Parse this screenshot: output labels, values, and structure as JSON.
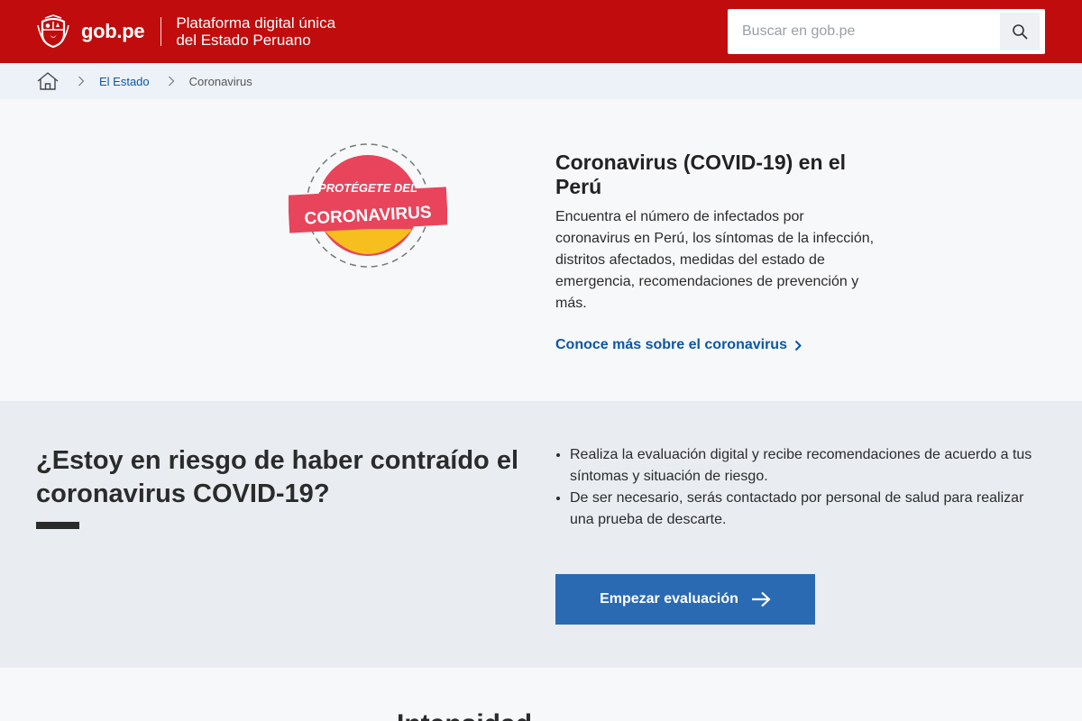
{
  "header": {
    "logo_text": "gob.pe",
    "tagline_line1": "Plataforma digital única",
    "tagline_line2": "del Estado Peruano",
    "search_placeholder": "Buscar en gob.pe",
    "brand_color": "#c00c0c"
  },
  "breadcrumb": {
    "items": [
      {
        "label": "El Estado"
      },
      {
        "label": "Coronavirus"
      }
    ]
  },
  "hero": {
    "badge_line1": "PROTÉGETE DEL",
    "badge_line2": "CORONAVIRUS",
    "title": "Coronavirus (COVID-19) en el Perú",
    "description": "Encuentra el número de infectados por coronavirus en Perú, los síntomas de la infección, distritos afectados, medidas del estado de emergencia, recomendaciones de prevención y más.",
    "link_label": "Conoce más sobre el coronavirus",
    "link_color": "#0b57a7"
  },
  "risk": {
    "title": "¿Estoy en riesgo de haber contraído el coronavirus COVID-19?",
    "bullets": [
      "Realiza la evaluación digital y recibe recomendaciones de acuerdo a tus síntomas y situación de riesgo.",
      "De ser necesario, serás contactado por personal de salud para realizar una prueba de descarte."
    ],
    "cta_label": "Empezar evaluación",
    "cta_color": "#2a6ab2"
  },
  "bottom": {
    "title_partial": "Intensidad"
  }
}
